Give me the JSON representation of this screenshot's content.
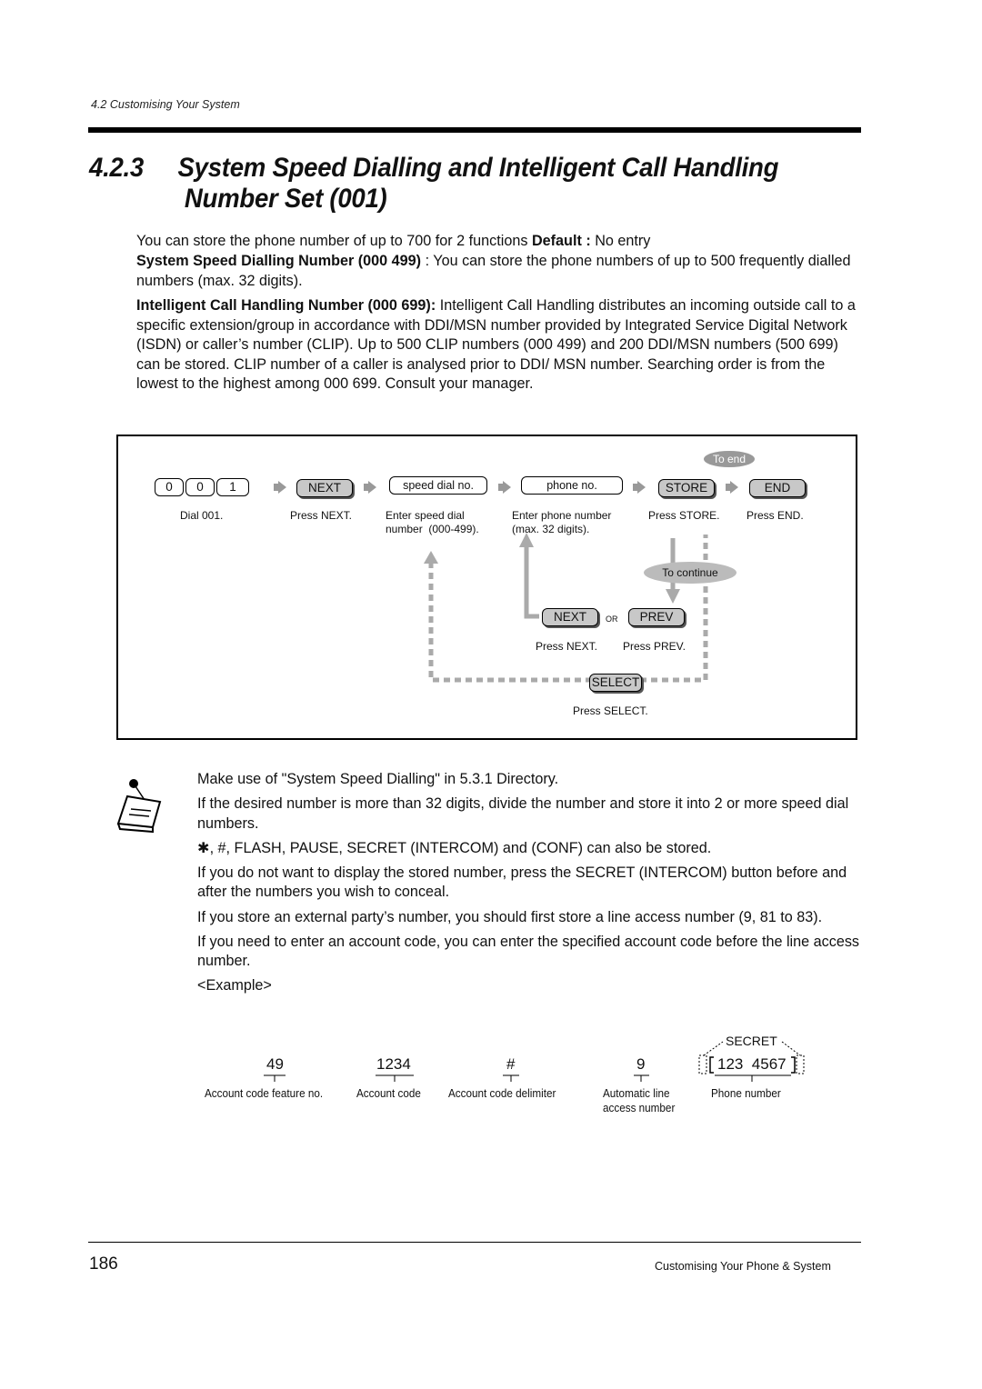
{
  "header": {
    "breadcrumb": "4.2  Customising Your System"
  },
  "title": {
    "number": "4.2.3",
    "line1": "System Speed Dialling and Intelligent Call Handling",
    "line2": "Number Set (001)"
  },
  "intro": {
    "line1_text": "You can store the phone number of up to 700 for 2 functions ",
    "default_label": "Default :",
    "default_value": " No entry",
    "ssd_label": "System Speed Dialling Number (000   499)",
    "ssd_text": " : You can store the phone numbers of up to 500 frequently dialled numbers (max. 32 digits).",
    "ich_label": "Intelligent Call Handling Number (000   699):",
    "ich_text": "  Intelligent Call Handling distributes an incoming outside call to a specific extension/group in accordance with DDI/MSN number provided by Integrated Service Digital Network (ISDN) or caller’s number (CLIP). Up to 500 CLIP numbers (000   499) and 200 DDI/MSN numbers (500   699) can be stored. CLIP number of a caller is analysed prior to DDI/ MSN number. Searching order is from the lowest to the highest among 000   699. Consult your manager."
  },
  "diagram": {
    "dial_keys": [
      "0",
      "0",
      "1"
    ],
    "steps": [
      {
        "key": "NEXT",
        "caption": "Press NEXT."
      },
      {
        "key": "speed dial no.",
        "caption": "Enter speed dial\nnumber  (000-499)."
      },
      {
        "key": "phone no.",
        "caption": "Enter phone number\n(max. 32 digits)."
      },
      {
        "key": "STORE",
        "caption": "Press STORE."
      },
      {
        "key": "END",
        "caption": "Press END."
      }
    ],
    "dial_caption": "Dial 001.",
    "to_end": "To end",
    "to_continue": "To continue",
    "next_key": "NEXT",
    "or_label": "OR",
    "prev_key": "PREV",
    "next_caption": "Press NEXT.",
    "prev_caption": "Press PREV.",
    "select_key": "SELECT",
    "select_caption": "Press SELECT."
  },
  "notes": [
    "Make use of \"System Speed Dialling\" in 5.3.1    Directory.",
    "If the desired number is more than 32 digits, divide the number and store it into 2 or more speed dial numbers.",
    "✱, #, FLASH, PAUSE, SECRET (INTERCOM) and   (CONF) can also be stored.",
    "If you do not want to display the stored number, press the SECRET (INTERCOM) button before and after the numbers you wish to conceal.",
    "If you store an external party’s number, you should first store a line access number (9, 81 to 83).",
    "If you need to enter an account code, you can enter the specified account code before the line access number.",
    "<Example>"
  ],
  "example": {
    "secret_label": "SECRET",
    "items": [
      {
        "value": "49",
        "caption": "Account code feature no."
      },
      {
        "value": "1234",
        "caption": "Account code"
      },
      {
        "value": "#",
        "caption": "Account code delimiter"
      },
      {
        "value": "9",
        "caption": "Automatic line\naccess number"
      },
      {
        "value": "123  4567",
        "caption": "Phone number"
      }
    ]
  },
  "footer": {
    "page_number": "186",
    "book_title": "Customising Your Phone & System"
  }
}
